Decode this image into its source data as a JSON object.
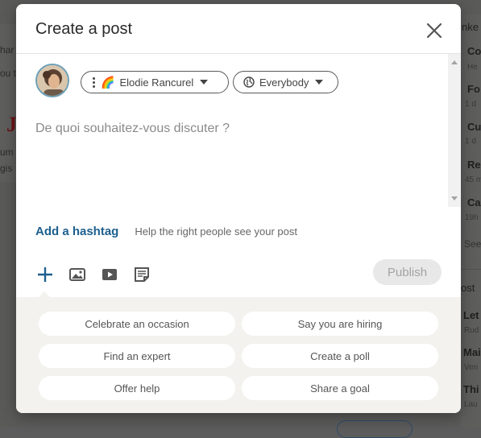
{
  "background": {
    "left_snippets": [
      "har",
      "ou t",
      "J",
      "um",
      "gis"
    ],
    "right_items": [
      {
        "title": "Co",
        "sub": "He"
      },
      {
        "title": "Fo",
        "sub": "1 d"
      },
      {
        "title": "Cu",
        "sub": "1 d"
      },
      {
        "title": "Re",
        "sub": "45 m"
      },
      {
        "title": "Ca",
        "sub": "19h"
      }
    ],
    "right_see": "See",
    "right_lower": [
      {
        "title": "ost",
        "sub": ""
      },
      {
        "title": "Let",
        "sub": "Rud"
      },
      {
        "title": "Mai",
        "sub": "Ven"
      },
      {
        "title": "Thi",
        "sub": "Lau"
      }
    ],
    "right_top": "nke"
  },
  "modal": {
    "title": "Create a post",
    "close_icon": "close-icon",
    "author": {
      "name": "Elodie Rancurel",
      "badge": "🌈"
    },
    "audience": "Everybody",
    "placeholder": "De quoi souhaitez-vous discuter ?",
    "hashtag_link": "Add a hashtag",
    "hashtag_help": "Help the right people see your post",
    "toolbar": {
      "icons": [
        "plus-icon",
        "photo-icon",
        "video-icon",
        "document-icon"
      ]
    },
    "publish_label": "Publish",
    "suggestions": [
      "Celebrate an occasion",
      "Say you are hiring",
      "Find an expert",
      "Create a poll",
      "Offer help",
      "Share a goal"
    ]
  },
  "colors": {
    "accent": "#1d5f8f",
    "overlay": "#5a5a59",
    "panel": "#f3f2ef"
  }
}
